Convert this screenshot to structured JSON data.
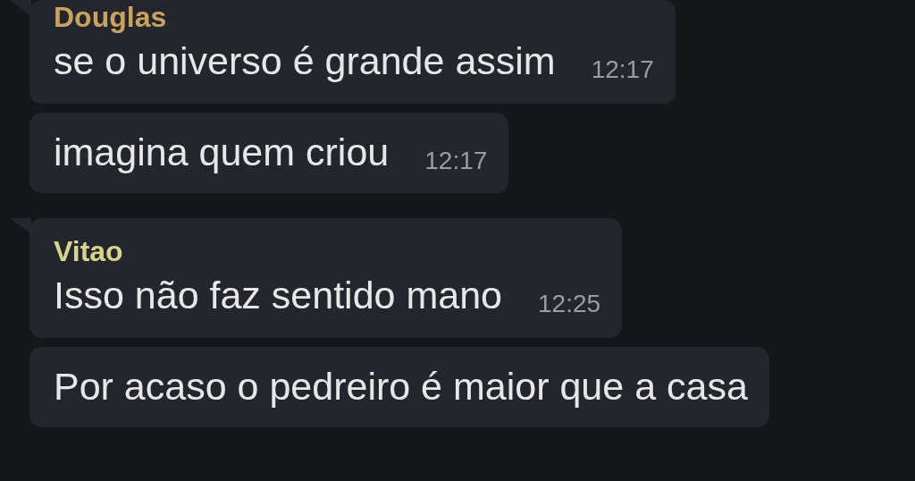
{
  "groups": [
    {
      "sender": "Douglas",
      "color": "#c9a25e",
      "messages": [
        {
          "text": "se o universo é grande assim",
          "time": "12:17"
        },
        {
          "text": "imagina quem criou",
          "time": "12:17"
        }
      ]
    },
    {
      "sender": "Vitao",
      "color": "#d8d48c",
      "messages": [
        {
          "text": "Isso não faz sentido mano",
          "time": "12:25"
        },
        {
          "text": "Por acaso o pedreiro é maior que a casa"
        }
      ]
    }
  ]
}
